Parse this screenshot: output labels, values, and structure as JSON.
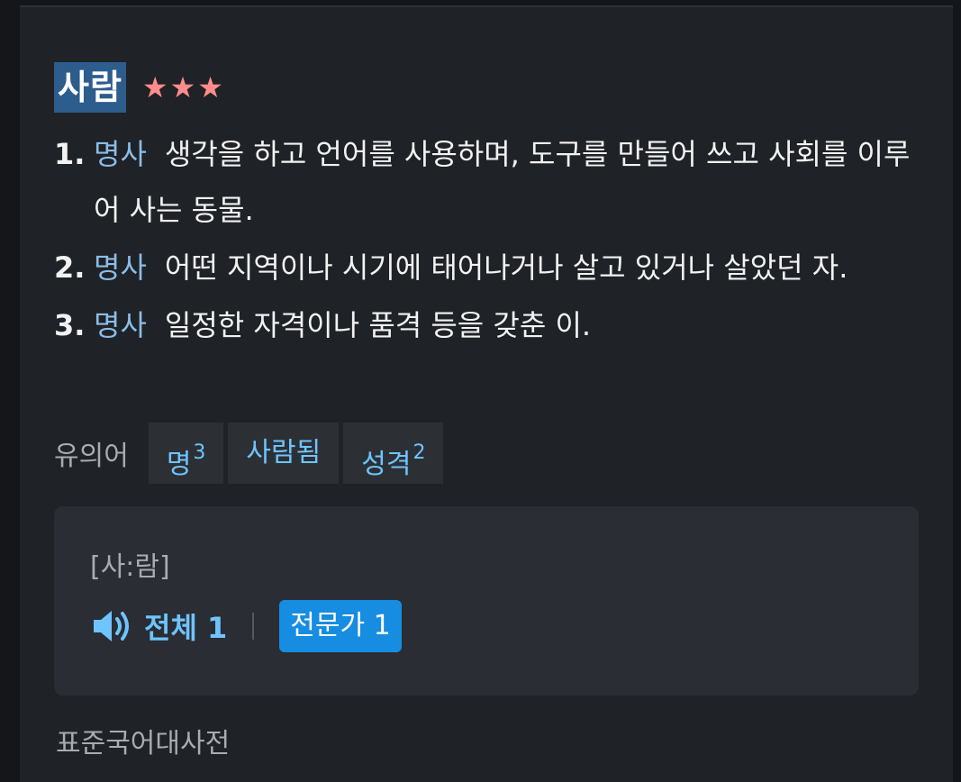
{
  "entry": {
    "headword": "사람",
    "stars": "★★★"
  },
  "senses": [
    {
      "num": "1.",
      "pos": "명사",
      "def": "생각을 하고 언어를 사용하며, 도구를 만들어 쓰고 사회를 이루어 사는 동물."
    },
    {
      "num": "2.",
      "pos": "명사",
      "def": "어떤 지역이나 시기에 태어나거나 살고 있거나 살았던 자."
    },
    {
      "num": "3.",
      "pos": "명사",
      "def": "일정한 자격이나 품격 등을 갖춘 이."
    }
  ],
  "synonyms": {
    "label": "유의어",
    "items": [
      {
        "word": "명",
        "sup": "3"
      },
      {
        "word": "사람됨",
        "sup": ""
      },
      {
        "word": "성격",
        "sup": "2"
      }
    ]
  },
  "pronunciation": {
    "text": "[사:람]",
    "all_label": "전체 1",
    "expert_label": "전문가 1"
  },
  "source": "표준국어대사전",
  "colors": {
    "accent": "#6fc4ff",
    "pos": "#8cbde8",
    "stars": "#ff8c8c",
    "headword_bg": "#2c5d8d",
    "button": "#168de0"
  }
}
